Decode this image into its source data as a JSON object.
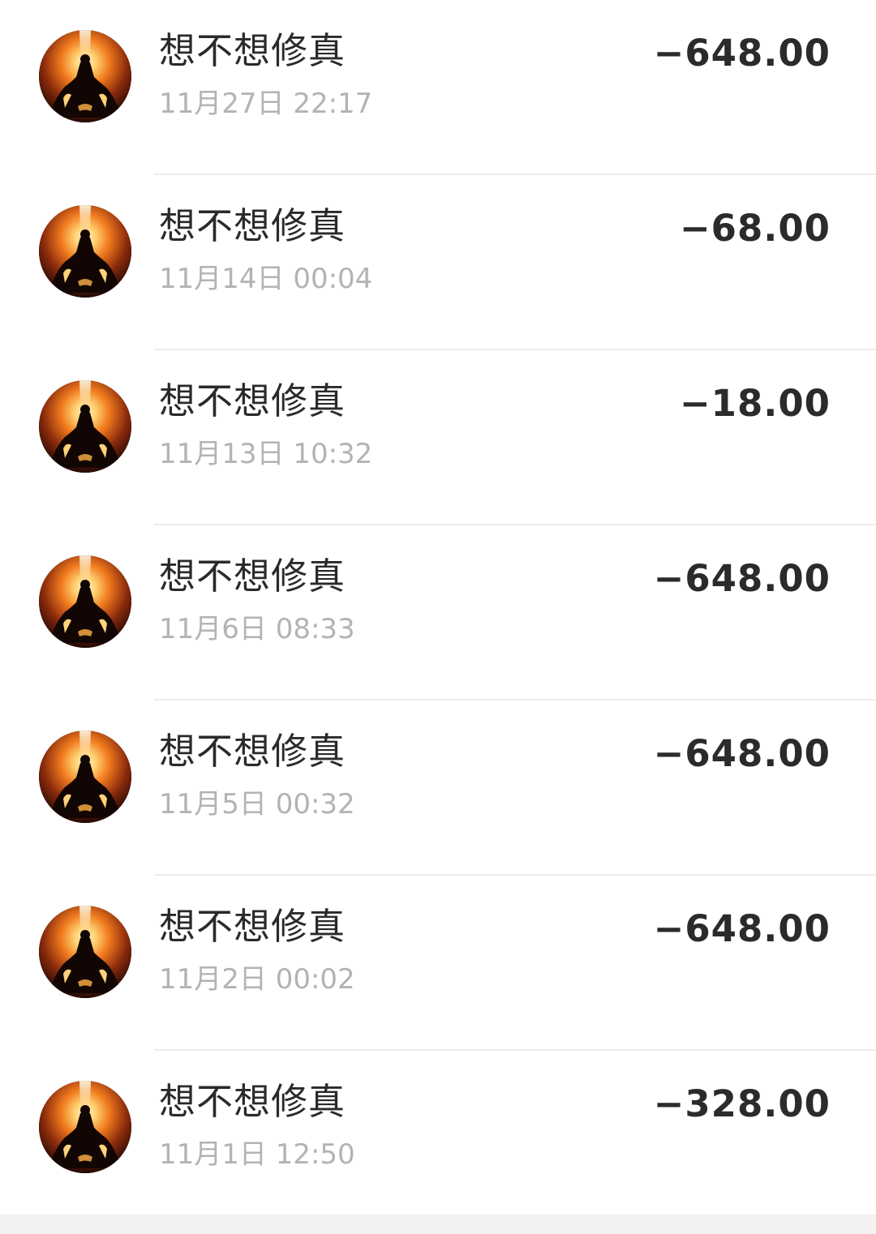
{
  "transactions": [
    {
      "name": "想不想修真",
      "time": "11月27日 22:17",
      "amount": "−648.00"
    },
    {
      "name": "想不想修真",
      "time": "11月14日 00:04",
      "amount": "−68.00"
    },
    {
      "name": "想不想修真",
      "time": "11月13日 10:32",
      "amount": "−18.00"
    },
    {
      "name": "想不想修真",
      "time": "11月6日 08:33",
      "amount": "−648.00"
    },
    {
      "name": "想不想修真",
      "time": "11月5日 00:32",
      "amount": "−648.00"
    },
    {
      "name": "想不想修真",
      "time": "11月2日 00:02",
      "amount": "−648.00"
    },
    {
      "name": "想不想修真",
      "time": "11月1日 12:50",
      "amount": "−328.00"
    }
  ],
  "avatar_icon": "meditating-cultivator-icon",
  "colors": {
    "title": "#2a2a2a",
    "time": "#b3b3b3",
    "amount": "#2b2b2b",
    "divider": "#ececec"
  }
}
